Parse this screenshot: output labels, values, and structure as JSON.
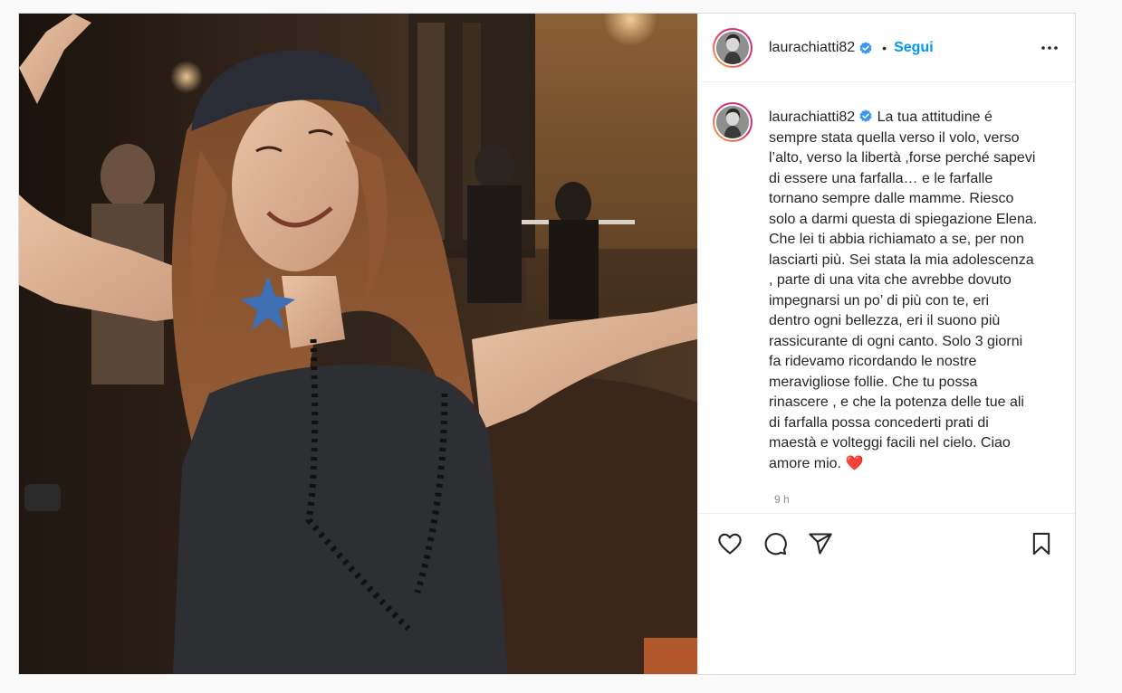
{
  "post": {
    "username": "laurachiatti82",
    "dot": "•",
    "follow_label": "Segui",
    "caption_user": "laurachiatti82",
    "caption_lines": [
      "La tua attitudine é",
      "sempre stata quella verso il volo, verso",
      "l’alto, verso la libertà ,forse perché sapevi",
      "di essere una farfalla… e le farfalle",
      "tornano sempre dalle mamme. Riesco",
      "solo a darmi questa di spiegazione Elena.",
      "Che lei ti abbia richiamato a se, per non",
      "lasciarti più. Sei stata la mia adolescenza",
      ", parte di una vita che avrebbe dovuto",
      "impegnarsi un po’ di più con te, eri",
      "dentro ogni bellezza, eri il suono più",
      "rassicurante di ogni canto. Solo 3 giorni",
      "fa ridevamo ricordando le nostre",
      "meravigliose follie. Che tu possa",
      "rinascere , e che la potenza delle tue ali",
      "di farfalla possa concederti prati di",
      "maestà e volteggi facili nel cielo. Ciao",
      "amore mio."
    ],
    "caption_emoji": "❤️",
    "time": "9 h"
  },
  "icons": {
    "verified": "verified-badge-icon",
    "more": "more-options-icon",
    "like": "heart-icon",
    "comment": "comment-icon",
    "share": "share-icon",
    "save": "bookmark-icon"
  },
  "colors": {
    "accent": "#0095f6",
    "verified": "#3897f0",
    "text": "#262626",
    "muted": "#8e8e8e",
    "heart": "#ed4956"
  }
}
